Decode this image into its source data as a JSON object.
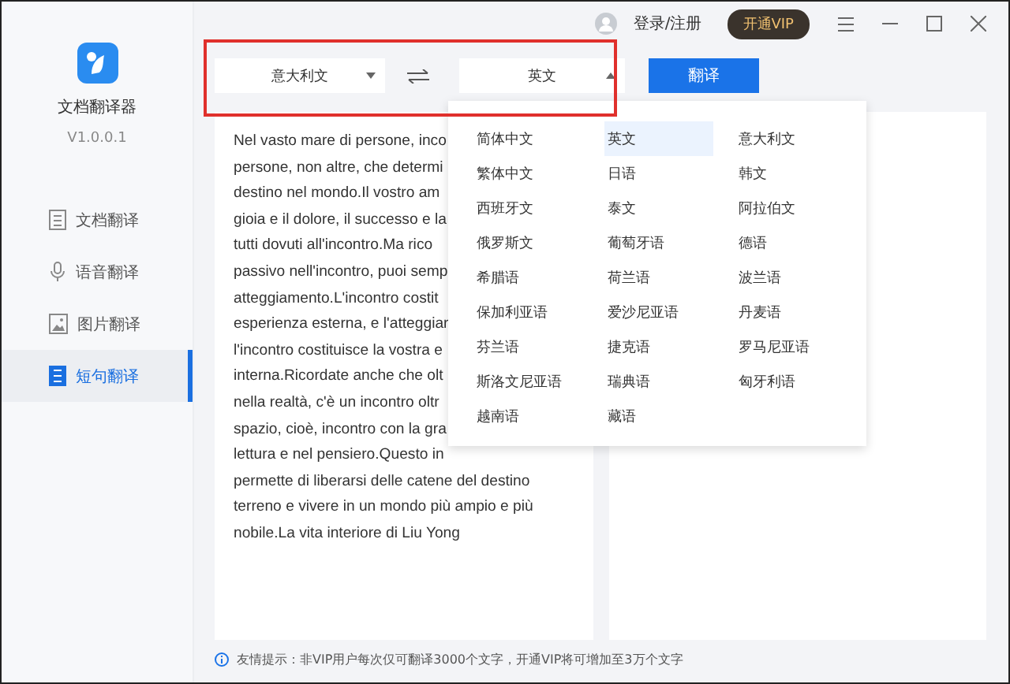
{
  "app": {
    "name": "文档翻译器",
    "version": "V1.0.0.1"
  },
  "sidebar": {
    "items": [
      {
        "label": "文档翻译",
        "selected": false
      },
      {
        "label": "语音翻译",
        "selected": false
      },
      {
        "label": "图片翻译",
        "selected": false
      },
      {
        "label": "短句翻译",
        "selected": true
      }
    ]
  },
  "header": {
    "login": "登录/注册",
    "vip_button": "开通VIP"
  },
  "translator": {
    "source_language": "意大利文",
    "target_language": "英文",
    "translate_button": "翻译",
    "source_text_lines": [
      "Nel vasto mare di persone, inco",
      "persone, non altre, che determi",
      "destino nel mondo.Il vostro am",
      "gioia e il dolore, il successo e la",
      "tutti dovuti all'incontro.Ma rico",
      "passivo nell'incontro, puoi semp",
      "atteggiamento.L'incontro costit",
      "esperienza esterna, e l'atteggiar",
      "l'incontro costituisce la vostra e",
      "interna.Ricordate anche che olt",
      "nella realtà, c'è un incontro oltr",
      "spazio, cioè, incontro con la gra",
      "lettura e nel pensiero.Questo in",
      "permette di liberarsi delle catene del destino",
      "terreno e vivere in un mondo più ampio e più",
      "nobile.La vita interiore di Liu Yong"
    ]
  },
  "language_menu": {
    "expanded": true,
    "options": [
      {
        "label": "简体中文",
        "selected": false
      },
      {
        "label": "英文",
        "selected": true
      },
      {
        "label": "意大利文",
        "selected": false
      },
      {
        "label": "繁体中文",
        "selected": false
      },
      {
        "label": "日语",
        "selected": false
      },
      {
        "label": "韩文",
        "selected": false
      },
      {
        "label": "西班牙文",
        "selected": false
      },
      {
        "label": "泰文",
        "selected": false
      },
      {
        "label": "阿拉伯文",
        "selected": false
      },
      {
        "label": "俄罗斯文",
        "selected": false
      },
      {
        "label": "葡萄牙语",
        "selected": false
      },
      {
        "label": "德语",
        "selected": false
      },
      {
        "label": "希腊语",
        "selected": false
      },
      {
        "label": "荷兰语",
        "selected": false
      },
      {
        "label": "波兰语",
        "selected": false
      },
      {
        "label": "保加利亚语",
        "selected": false
      },
      {
        "label": "爱沙尼亚语",
        "selected": false
      },
      {
        "label": "丹麦语",
        "selected": false
      },
      {
        "label": "芬兰语",
        "selected": false
      },
      {
        "label": "捷克语",
        "selected": false
      },
      {
        "label": "罗马尼亚语",
        "selected": false
      },
      {
        "label": "斯洛文尼亚语",
        "selected": false
      },
      {
        "label": "瑞典语",
        "selected": false
      },
      {
        "label": "匈牙利语",
        "selected": false
      },
      {
        "label": "越南语",
        "selected": false
      },
      {
        "label": "藏语",
        "selected": false
      }
    ]
  },
  "footer_tip": "友情提示：非VIP用户每次仅可翻译3000个文字，开通VIP将可增加至3万个文字"
}
